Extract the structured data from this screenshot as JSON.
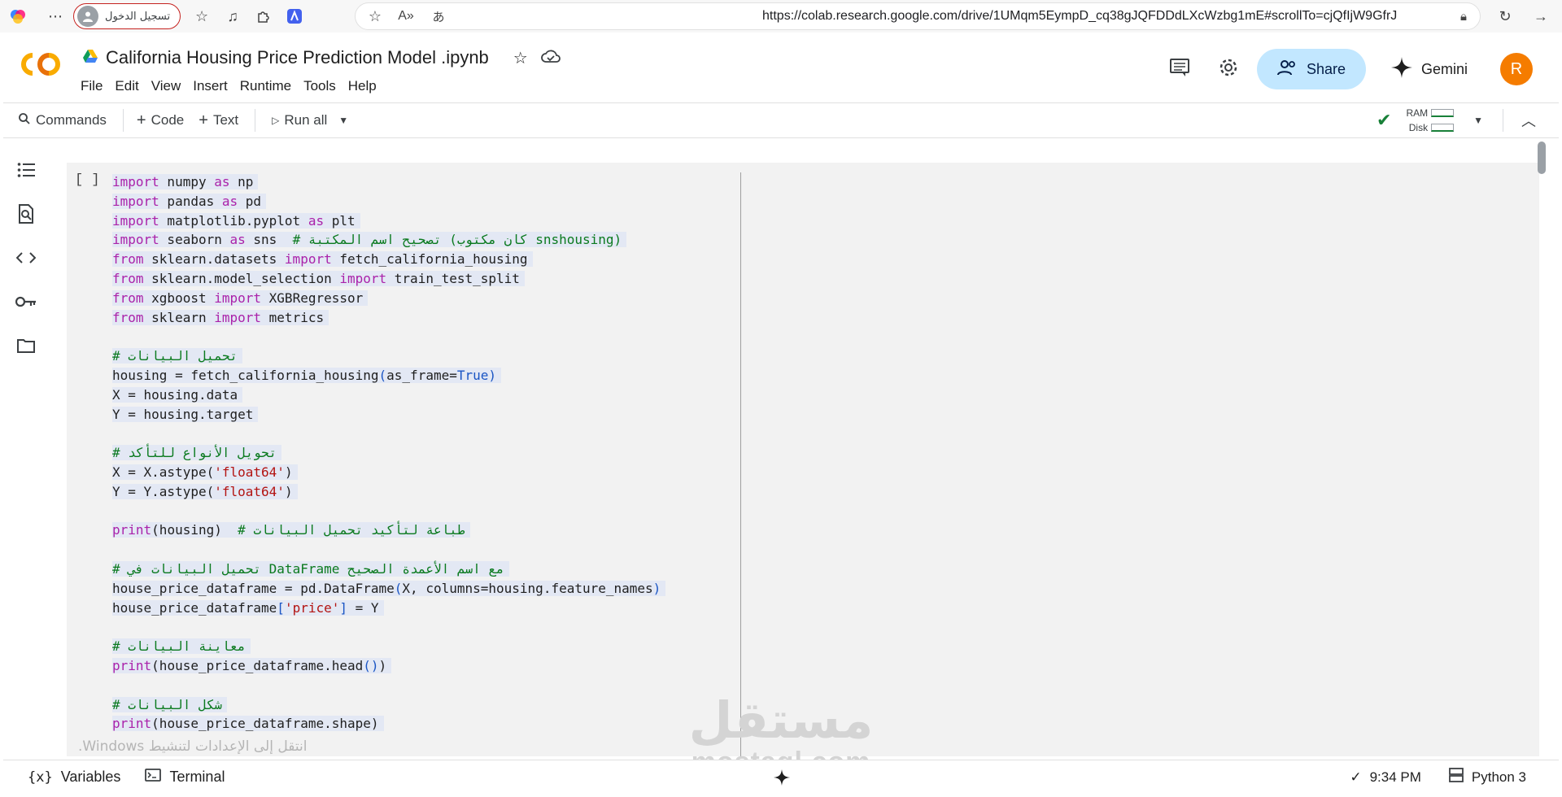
{
  "browser": {
    "signin_label": "تسجيل الدخول",
    "url": "https://colab.research.google.com/drive/1UMqm5EympD_cq38gJQFDDdLXcWzbg1mE#scrollTo=cjQfIjW9GfrJ"
  },
  "notebook": {
    "title": "California Housing Price Prediction Model .ipynb",
    "menu": [
      "File",
      "Edit",
      "View",
      "Insert",
      "Runtime",
      "Tools",
      "Help"
    ],
    "share_label": "Share",
    "gemini_label": "Gemini",
    "avatar_letter": "R"
  },
  "toolbar": {
    "commands": "Commands",
    "code": "Code",
    "text": "Text",
    "run_all": "Run all",
    "ram": "RAM",
    "disk": "Disk"
  },
  "cell": {
    "run_marker": "[ ]",
    "code_lines": [
      [
        {
          "t": "import",
          "c": "kw"
        },
        {
          "t": " numpy "
        },
        {
          "t": "as",
          "c": "kw"
        },
        {
          "t": " np"
        }
      ],
      [
        {
          "t": "import",
          "c": "kw"
        },
        {
          "t": " pandas "
        },
        {
          "t": "as",
          "c": "kw"
        },
        {
          "t": " pd"
        }
      ],
      [
        {
          "t": "import",
          "c": "kw"
        },
        {
          "t": " matplotlib.pyplot "
        },
        {
          "t": "as",
          "c": "kw"
        },
        {
          "t": " plt"
        }
      ],
      [
        {
          "t": "import",
          "c": "kw"
        },
        {
          "t": " seaborn "
        },
        {
          "t": "as",
          "c": "kw"
        },
        {
          "t": " sns  "
        },
        {
          "t": "# تصحيح اسم المكتبة (كان مكتوب snshousing)",
          "c": "cm"
        }
      ],
      [
        {
          "t": "from",
          "c": "kw"
        },
        {
          "t": " sklearn.datasets "
        },
        {
          "t": "import",
          "c": "kw"
        },
        {
          "t": " fetch_california_housing"
        }
      ],
      [
        {
          "t": "from",
          "c": "kw"
        },
        {
          "t": " sklearn.model_selection "
        },
        {
          "t": "import",
          "c": "kw"
        },
        {
          "t": " train_test_split"
        }
      ],
      [
        {
          "t": "from",
          "c": "kw"
        },
        {
          "t": " xgboost "
        },
        {
          "t": "import",
          "c": "kw"
        },
        {
          "t": " XGBRegressor"
        }
      ],
      [
        {
          "t": "from",
          "c": "kw"
        },
        {
          "t": " sklearn "
        },
        {
          "t": "import",
          "c": "kw"
        },
        {
          "t": " metrics"
        }
      ],
      [],
      [
        {
          "t": "# تحميل البيانات",
          "c": "cm"
        }
      ],
      [
        {
          "t": "housing = fetch_california_housing"
        },
        {
          "t": "(",
          "c": "bl"
        },
        {
          "t": "as_frame="
        },
        {
          "t": "True",
          "c": "bl"
        },
        {
          "t": ")",
          "c": "bl"
        }
      ],
      [
        {
          "t": "X = housing.data"
        }
      ],
      [
        {
          "t": "Y = housing.target"
        }
      ],
      [],
      [
        {
          "t": "# تحويل الأنواع للتأكد",
          "c": "cm"
        }
      ],
      [
        {
          "t": "X = X.astype("
        },
        {
          "t": "'float64'",
          "c": "str"
        },
        {
          "t": ")"
        }
      ],
      [
        {
          "t": "Y = Y.astype("
        },
        {
          "t": "'float64'",
          "c": "str"
        },
        {
          "t": ")"
        }
      ],
      [],
      [
        {
          "t": "print",
          "c": "kw"
        },
        {
          "t": "(housing)  "
        },
        {
          "t": "# طباعة لتأكيد تحميل البيانات",
          "c": "cm"
        }
      ],
      [],
      [
        {
          "t": "# تحميل البيانات في DataFrame مع اسم الأعمدة الصحيح",
          "c": "cm"
        }
      ],
      [
        {
          "t": "house_price_dataframe = pd.DataFrame"
        },
        {
          "t": "(",
          "c": "bl"
        },
        {
          "t": "X, columns=housing.feature_names"
        },
        {
          "t": ")",
          "c": "bl"
        }
      ],
      [
        {
          "t": "house_price_dataframe"
        },
        {
          "t": "[",
          "c": "bl"
        },
        {
          "t": "'price'",
          "c": "str"
        },
        {
          "t": "]",
          "c": "bl"
        },
        {
          "t": " = Y"
        }
      ],
      [],
      [
        {
          "t": "# معاينة البيانات",
          "c": "cm"
        }
      ],
      [
        {
          "t": "print",
          "c": "kw"
        },
        {
          "t": "(house_price_dataframe.head"
        },
        {
          "t": "()",
          "c": "bl"
        },
        {
          "t": ")"
        }
      ],
      [],
      [
        {
          "t": "# شكل البيانات",
          "c": "cm"
        }
      ],
      [
        {
          "t": "print",
          "c": "kw"
        },
        {
          "t": "(house_price_dataframe.shape)"
        }
      ]
    ]
  },
  "watermarks": {
    "windows_activate": "انتقل إلى الإعدادات لتنشيط Windows.",
    "mostaql_ar": "مستقل",
    "mostaql_en": "mostaql.com"
  },
  "status": {
    "variables": "Variables",
    "terminal": "Terminal",
    "time": "9:34 PM",
    "kernel": "Python 3"
  }
}
